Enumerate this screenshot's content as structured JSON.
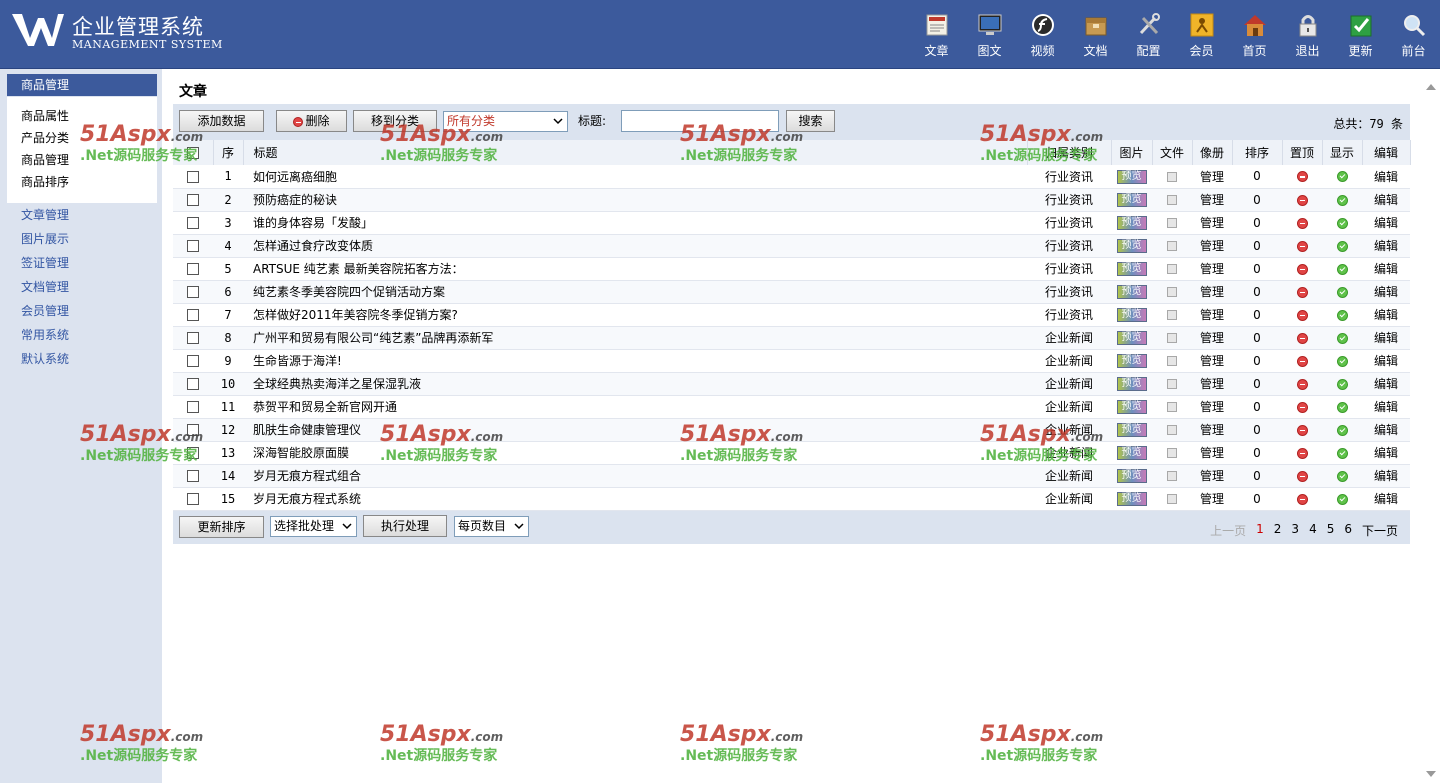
{
  "app": {
    "title_cn": "企业管理系统",
    "title_en": "MANAGEMENT SYSTEM"
  },
  "topnav": [
    {
      "label": "文章",
      "icon": "article-icon"
    },
    {
      "label": "图文",
      "icon": "monitor-icon"
    },
    {
      "label": "视频",
      "icon": "flash-icon"
    },
    {
      "label": "文档",
      "icon": "box-icon"
    },
    {
      "label": "配置",
      "icon": "tools-icon"
    },
    {
      "label": "会员",
      "icon": "member-icon"
    },
    {
      "label": "首页",
      "icon": "home-icon"
    },
    {
      "label": "退出",
      "icon": "lock-icon"
    },
    {
      "label": "更新",
      "icon": "checkmark-icon"
    },
    {
      "label": "前台",
      "icon": "magnifier-icon"
    }
  ],
  "sidebar": {
    "active_group": "商品管理",
    "sub_items": [
      "商品属性",
      "产品分类",
      "商品管理",
      "商品排序"
    ],
    "links": [
      "文章管理",
      "图片展示",
      "签证管理",
      "文档管理",
      "会员管理",
      "常用系统",
      "默认系统"
    ]
  },
  "main": {
    "title": "文章",
    "toolbar": {
      "add_label": "添加数据",
      "delete_label": "删除",
      "move_label": "移到分类",
      "category_selected": "所有分类",
      "title_label": "标题:",
      "title_value": "",
      "search_label": "搜索",
      "total_text": "总共：79 条"
    },
    "columns": [
      "序",
      "标题",
      "归属类别",
      "图片",
      "文件",
      "像册",
      "排序",
      "置顶",
      "显示",
      "编辑"
    ],
    "rows": [
      {
        "seq": "1",
        "title": "如何远离癌细胞",
        "category": "行业资讯",
        "album": "管理",
        "order": "0",
        "edit": "编辑"
      },
      {
        "seq": "2",
        "title": "预防癌症的秘诀",
        "category": "行业资讯",
        "album": "管理",
        "order": "0",
        "edit": "编辑"
      },
      {
        "seq": "3",
        "title": "谁的身体容易「发酸」",
        "category": "行业资讯",
        "album": "管理",
        "order": "0",
        "edit": "编辑"
      },
      {
        "seq": "4",
        "title": "怎样通过食疗改变体质",
        "category": "行业资讯",
        "album": "管理",
        "order": "0",
        "edit": "编辑"
      },
      {
        "seq": "5",
        "title": "ARTSUE 纯艺素 最新美容院拓客方法：",
        "category": "行业资讯",
        "album": "管理",
        "order": "0",
        "edit": "编辑"
      },
      {
        "seq": "6",
        "title": "纯艺素冬季美容院四个促销活动方案",
        "category": "行业资讯",
        "album": "管理",
        "order": "0",
        "edit": "编辑"
      },
      {
        "seq": "7",
        "title": "怎样做好2011年美容院冬季促销方案?",
        "category": "行业资讯",
        "album": "管理",
        "order": "0",
        "edit": "编辑"
      },
      {
        "seq": "8",
        "title": "广州平和贸易有限公司“纯艺素”品牌再添新军",
        "category": "企业新闻",
        "album": "管理",
        "order": "0",
        "edit": "编辑"
      },
      {
        "seq": "9",
        "title": "生命皆源于海洋!",
        "category": "企业新闻",
        "album": "管理",
        "order": "0",
        "edit": "编辑"
      },
      {
        "seq": "10",
        "title": "全球经典热卖海洋之星保湿乳液",
        "category": "企业新闻",
        "album": "管理",
        "order": "0",
        "edit": "编辑"
      },
      {
        "seq": "11",
        "title": "恭贺平和贸易全新官网开通",
        "category": "企业新闻",
        "album": "管理",
        "order": "0",
        "edit": "编辑"
      },
      {
        "seq": "12",
        "title": "肌肤生命健康管理仪",
        "category": "企业新闻",
        "album": "管理",
        "order": "0",
        "edit": "编辑"
      },
      {
        "seq": "13",
        "title": "深海智能胶原面膜",
        "category": "企业新闻",
        "album": "管理",
        "order": "0",
        "edit": "编辑"
      },
      {
        "seq": "14",
        "title": "岁月无痕方程式组合",
        "category": "企业新闻",
        "album": "管理",
        "order": "0",
        "edit": "编辑"
      },
      {
        "seq": "15",
        "title": "岁月无痕方程式系统",
        "category": "企业新闻",
        "album": "管理",
        "order": "0",
        "edit": "编辑"
      }
    ],
    "preview_label": "预览",
    "footer": {
      "update_order_label": "更新排序",
      "batch_selected": "选择批处理",
      "execute_label": "执行处理",
      "per_page_selected": "每页数目"
    },
    "pager": {
      "prev": "上一页",
      "pages": [
        "1",
        "2",
        "3",
        "4",
        "5",
        "6"
      ],
      "current": "1",
      "next": "下一页"
    }
  },
  "watermark": {
    "brand": "51Aspx",
    "domain": ".com",
    "slogan": ".Net源码服务专家"
  },
  "colors": {
    "header": "#3c5a9c",
    "sidebar": "#dce3ef",
    "link": "#3356a3",
    "panel": "#dbe3ef"
  }
}
